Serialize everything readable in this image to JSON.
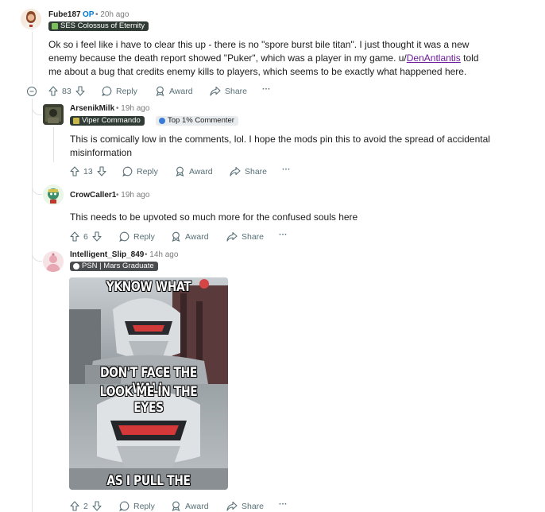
{
  "comments": [
    {
      "username": "Fube187",
      "op_badge": "OP",
      "time": "20h ago",
      "flair": "SES Colossus of Eternity",
      "body_part1": "Ok so i feel like i have to clear this up - there is no \"spore burst bile titan\". I just thought it was a new enemy because the death report showed \"Puker\", which was a player in my game. u/",
      "body_link": "DenAntlantis",
      "body_part2": " told me about a bug that credits enemy kills to players, which seems to be exactly what happened here.",
      "votes": "83",
      "reply_label": "Reply",
      "award_label": "Award",
      "share_label": "Share",
      "more_label": "···"
    },
    {
      "username": "ArsenikMilk",
      "time": "19h ago",
      "flair": "Viper Commando",
      "flair2": "Top 1% Commenter",
      "body": "This is comically low in the comments, lol. I hope the mods pin this to avoid the spread of accidental misinformation",
      "votes": "13",
      "reply_label": "Reply",
      "award_label": "Award",
      "share_label": "Share",
      "more_label": "···"
    },
    {
      "username": "CrowCaller1",
      "time": "19h ago",
      "body": "This needs to be upvoted so much more for the confused souls here",
      "votes": "6",
      "reply_label": "Reply",
      "award_label": "Award",
      "share_label": "Share",
      "more_label": "···"
    },
    {
      "username": "Intelligent_Slip_849",
      "time": "14h ago",
      "flair": "PSN | Mars Graduate",
      "meme_top": "YKNOW WHAT",
      "meme_mid1": "DON'T FACE THE WALL",
      "meme_mid2": "LOOK ME IN THE EYES",
      "meme_bottom": "AS I PULL THE TRIGGER",
      "votes": "2",
      "reply_label": "Reply",
      "award_label": "Award",
      "share_label": "Share",
      "more_label": "···"
    }
  ],
  "colors": {
    "flair_bg_dark": "#2f3b34",
    "flair_bg_light": "#e9ecee",
    "link": "#6a1b9a",
    "op": "#0079d3",
    "meta": "#7c7c7c",
    "action": "#576f76"
  },
  "icons": [
    "upvote-icon",
    "downvote-icon",
    "reply-icon",
    "award-icon",
    "share-icon",
    "more-icon",
    "collapse-icon"
  ]
}
